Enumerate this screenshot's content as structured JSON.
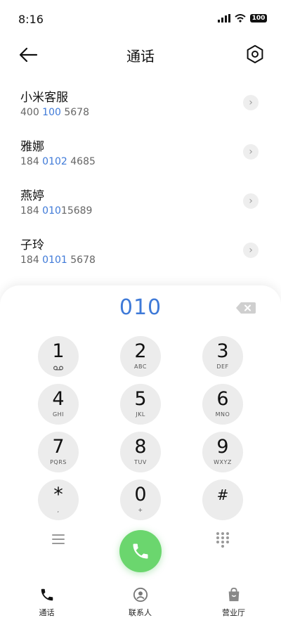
{
  "status_bar": {
    "time": "8:16",
    "battery": "100"
  },
  "header": {
    "title": "通话"
  },
  "contacts": [
    {
      "name": "小米客服",
      "num_pre": "400 ",
      "num_hl": "100",
      "num_post": " 5678"
    },
    {
      "name": "雅娜",
      "num_pre": "184 ",
      "num_hl": "0102",
      "num_post": " 4685"
    },
    {
      "name": "燕婷",
      "num_pre": "184 ",
      "num_hl": "010",
      "num_post": "15689"
    },
    {
      "name": "子玲",
      "num_pre": "184 ",
      "num_hl": "0101",
      "num_post": " 5678"
    }
  ],
  "dialer": {
    "input": "010",
    "keys": [
      {
        "digit": "1",
        "letters": ""
      },
      {
        "digit": "2",
        "letters": "ABC"
      },
      {
        "digit": "3",
        "letters": "DEF"
      },
      {
        "digit": "4",
        "letters": "GHI"
      },
      {
        "digit": "5",
        "letters": "JKL"
      },
      {
        "digit": "6",
        "letters": "MNO"
      },
      {
        "digit": "7",
        "letters": "PQRS"
      },
      {
        "digit": "8",
        "letters": "TUV"
      },
      {
        "digit": "9",
        "letters": "WXYZ"
      },
      {
        "digit": "*",
        "letters": ","
      },
      {
        "digit": "0",
        "letters": "+"
      },
      {
        "digit": "#",
        "letters": ""
      }
    ]
  },
  "tabs": [
    {
      "label": "通话",
      "icon": "phone-icon"
    },
    {
      "label": "联系人",
      "icon": "contact-icon"
    },
    {
      "label": "营业厅",
      "icon": "bag-icon"
    }
  ],
  "colors": {
    "accent": "#3f7ad8",
    "call_green": "#6bd66e"
  }
}
